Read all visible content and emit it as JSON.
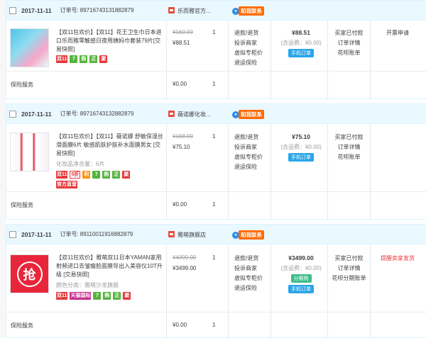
{
  "orders": [
    {
      "date": "2017-11-11",
      "order_no_label": "订单号:",
      "order_no": "89716743131882879",
      "shop": "乐而雅官方...",
      "ww": "和我联系",
      "title": "【双11狂欢价】【双11】花王卫生巾日本进口乐而雅零触感日夜用姨妈巾套装79片[交易快照]",
      "tags": [
        "双11",
        "7",
        "购",
        "正",
        "聚"
      ],
      "meta": "",
      "official": "",
      "price_old": "¥160.00",
      "price_new": "¥88.51",
      "qty": "1",
      "services": [
        "退款/退货",
        "投诉商家",
        "虚拟专柜价",
        "退运保险"
      ],
      "total": "¥88.51",
      "shipping": "(含运费：¥0.00)",
      "pay_btn": "手机订单",
      "status": [
        "买家已付款",
        "订单详情",
        "花呗账单"
      ],
      "action": "开票申请",
      "service_label": "保险服务",
      "service_amt": "¥0.00",
      "service_qty": "1"
    },
    {
      "date": "2017-11-11",
      "order_no_label": "订单号:",
      "order_no": "89716743132882879",
      "shop": "薇诺娜化妆...",
      "ww": "和我联系",
      "title": "【双11狂欢价】【双11】薇诺娜 舒敏保湿丝滑面膜6片 敏感肌肤护肤补水面膜男女 [交易快照]",
      "tags": [
        "双11",
        "5折",
        "积",
        "7",
        "购",
        "正",
        "聚"
      ],
      "meta": "化妆品净含量：6片",
      "official": "官方直营",
      "price_old": "¥168.00",
      "price_new": "¥75.10",
      "qty": "1",
      "services": [
        "退款/退货",
        "投诉商家",
        "虚拟专柜价",
        "退运保险"
      ],
      "total": "¥75.10",
      "shipping": "(含运费：¥0.00)",
      "pay_btn": "手机订单",
      "status": [
        "买家已付款",
        "订单详情",
        "花呗账单"
      ],
      "action": "",
      "service_label": "保险服务",
      "service_amt": "¥0.00",
      "service_qty": "1"
    },
    {
      "date": "2017-11-11",
      "order_no_label": "订单号:",
      "order_no": "89110011916882879",
      "shop": "雅萌旗舰店",
      "ww": "和我联系",
      "title": "【双11狂欢价】雅萌双11日本YAMAN家用射频进口去皱瘦脸面膜导出入美容仪10T升级 [交易快照]",
      "tags": [
        "双11",
        "天猫国际",
        "7",
        "购",
        "正",
        "聚"
      ],
      "meta": "颜色分类：雅萌沙龙旗舰",
      "official": "",
      "price_old": "¥4399.00",
      "price_new": "¥3499.00",
      "qty": "1",
      "services": [
        "退款/退货",
        "投诉商家",
        "虚拟专柜价",
        "退运保险"
      ],
      "total": "¥3499.00",
      "shipping": "(含运费：¥0.00)",
      "pay_btn": "分期购",
      "pay_btn2": "手机订单",
      "status": [
        "买家已付款",
        "订单详情",
        "花呗分期账单"
      ],
      "action": "提醒卖家发货",
      "service_label": "保险服务",
      "service_amt": "¥0.00",
      "service_qty": "1",
      "thumb_text": "抢"
    }
  ]
}
